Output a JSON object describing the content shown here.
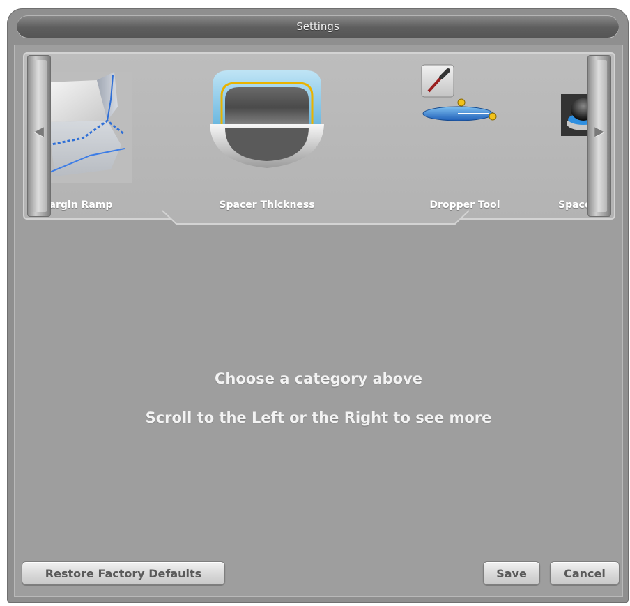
{
  "window": {
    "title": "Settings"
  },
  "carousel": {
    "left_arrow": "◀",
    "right_arrow": "▶",
    "items": [
      {
        "label": "Margin Ramp",
        "icon": "margin-ramp-icon"
      },
      {
        "label": "Spacer Thickness",
        "icon": "spacer-thickness-icon"
      },
      {
        "label": "Dropper Tool",
        "icon": "dropper-tool-icon"
      },
      {
        "label": "Spaceba",
        "icon": "spaceball-icon"
      }
    ]
  },
  "main": {
    "prompt": "Choose a category above",
    "hint": "Scroll to the Left or the Right to see more"
  },
  "footer": {
    "restore_label": "Restore Factory Defaults",
    "save_label": "Save",
    "cancel_label": "Cancel"
  },
  "colors": {
    "panel_bg": "#9e9e9e",
    "title_bg": "#5e5e5e",
    "accent_blue": "#2f6fd6",
    "accent_yellow": "#e9b300"
  }
}
